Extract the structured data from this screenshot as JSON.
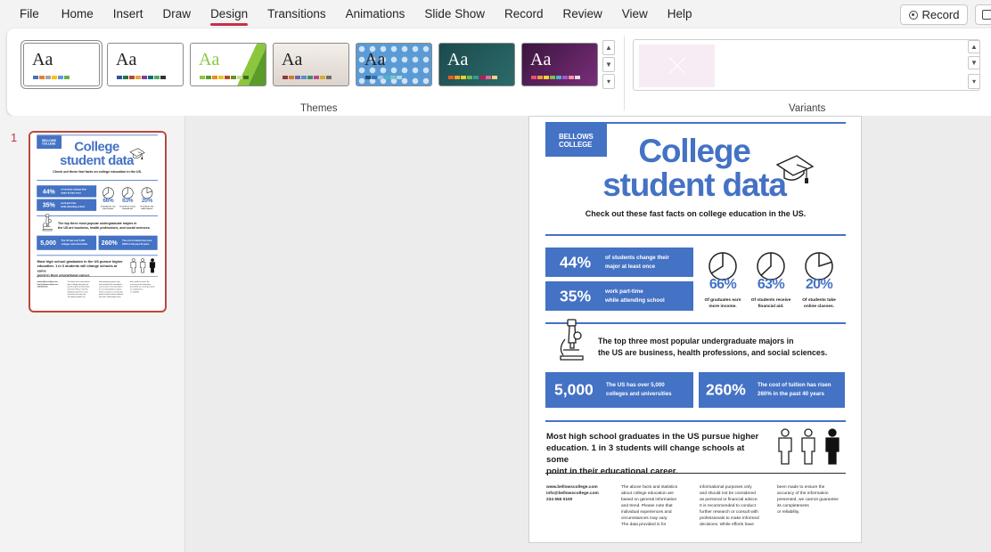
{
  "menu": {
    "items": [
      "File",
      "Home",
      "Insert",
      "Draw",
      "Design",
      "Transitions",
      "Animations",
      "Slide Show",
      "Record",
      "Review",
      "View",
      "Help"
    ],
    "active": "Design",
    "record_button": "Record"
  },
  "ribbon": {
    "themes_label": "Themes",
    "variants_label": "Variants",
    "themes": [
      {
        "name": "office-theme",
        "text": "Aa",
        "bg": "#ffffff",
        "text_color": "#222222",
        "swatches": [
          "#4472c4",
          "#ed7d31",
          "#a5a5a5",
          "#ffc000",
          "#5b9bd5",
          "#70ad47"
        ]
      },
      {
        "name": "office-theme-2",
        "text": "Aa",
        "bg": "#ffffff",
        "text_color": "#222222",
        "swatches": [
          "#2b579a",
          "#217346",
          "#b7472a",
          "#e8a33d",
          "#7a3e9d",
          "#0e6e6e",
          "#55a868",
          "#333333"
        ]
      },
      {
        "name": "facet-theme",
        "text": "Aa",
        "bg": "#ffffff",
        "text_color": "#8cc63f",
        "swatches": [
          "#8cc63f",
          "#5a9b2a",
          "#ef8a1f",
          "#e8c32a",
          "#b94b1f",
          "#6b8f2e",
          "#c5dd9a",
          "#3d6e1d"
        ]
      },
      {
        "name": "integral-theme",
        "text": "Aa",
        "bg": "#ebe5df",
        "text_color": "#222222",
        "swatches": [
          "#8e3a3a",
          "#c97b38",
          "#6e63a8",
          "#5b8fc9",
          "#3f8f6b",
          "#b94a8a",
          "#d8a83a",
          "#6d6d6d"
        ]
      },
      {
        "name": "ion-boardroom-theme",
        "text": "Aa",
        "bg": "#5b9bd5",
        "text_color": "#222222",
        "swatches": [
          "#1f4e79",
          "#2e75b6",
          "#9dc3e6",
          "#4fb3bf",
          "#7ac6d3",
          "#b0d8e6"
        ]
      },
      {
        "name": "ion-theme",
        "text": "Aa",
        "bg": "#1f4e52",
        "text_color": "#ffffff",
        "swatches": [
          "#ef5b25",
          "#f4a81d",
          "#e8cf2a",
          "#7ab648",
          "#2f9c95",
          "#c2185b",
          "#f06292",
          "#ffd180"
        ]
      },
      {
        "name": "organic-theme",
        "text": "Aa",
        "bg": "#4b1d4f",
        "text_color": "#ffffff",
        "swatches": [
          "#e94e77",
          "#f29c38",
          "#f5d33a",
          "#7fbf4d",
          "#4fb0d0",
          "#a05fc2",
          "#ff8fab",
          "#e1e1e1"
        ]
      }
    ]
  },
  "slide_panel": {
    "number": "1"
  },
  "slide": {
    "logo": [
      "BELLOWS",
      "COLLEGE"
    ],
    "title_line1": "College",
    "title_line2": "student data",
    "subtitle": "Check out these fast facts on college education in the US.",
    "stat1": {
      "value": "44%",
      "text1": "of students change their",
      "text2": "major at least once"
    },
    "stat2": {
      "value": "35%",
      "text1": "work part-time",
      "text2": "while attending school"
    },
    "pies": [
      {
        "pct": "66%",
        "cap1": "Of graduates earn",
        "cap2": "more income.",
        "value": 66
      },
      {
        "pct": "63%",
        "cap1": "Of students receive",
        "cap2": "financial aid.",
        "value": 63
      },
      {
        "pct": "20%",
        "cap1": "Of students take",
        "cap2": "online classes.",
        "value": 20
      }
    ],
    "majors1": "The top three most popular undergraduate majors in",
    "majors2": "the US are business, health professions, and social sciences.",
    "stat3": {
      "value": "5,000",
      "text1": "The US has over 5,000",
      "text2": "colleges and universities"
    },
    "stat4": {
      "value": "260%",
      "text1": "The cost of tuition has risen",
      "text2": "260% in the past 40 years"
    },
    "grads1": "Most high school graduates in the US pursue higher",
    "grads2": "education. 1 in 3 students will change schools at some",
    "grads3": "point in their educational career.",
    "contact": [
      "www.bellowscollege.com",
      "info@bellowscollege.com",
      "234 555 0100"
    ],
    "disclaimer1": [
      "The above facts and statistics",
      "about college education are",
      "based on general information",
      "and trend. Please note that",
      "individual experiences and",
      "circumstances may vary.",
      "The data provided is for"
    ],
    "disclaimer2": [
      "informational purposes only",
      "and should not be considered",
      "as personal or financial advice.",
      "It is recommended to conduct",
      "further research  or consult with",
      "professionals to make informed",
      "decisions. While efforts have"
    ],
    "disclaimer3": [
      "been made to ensure the",
      "accuracy of the information",
      "presented, we cannot guarantee",
      "its completeness",
      "or reliability."
    ]
  }
}
